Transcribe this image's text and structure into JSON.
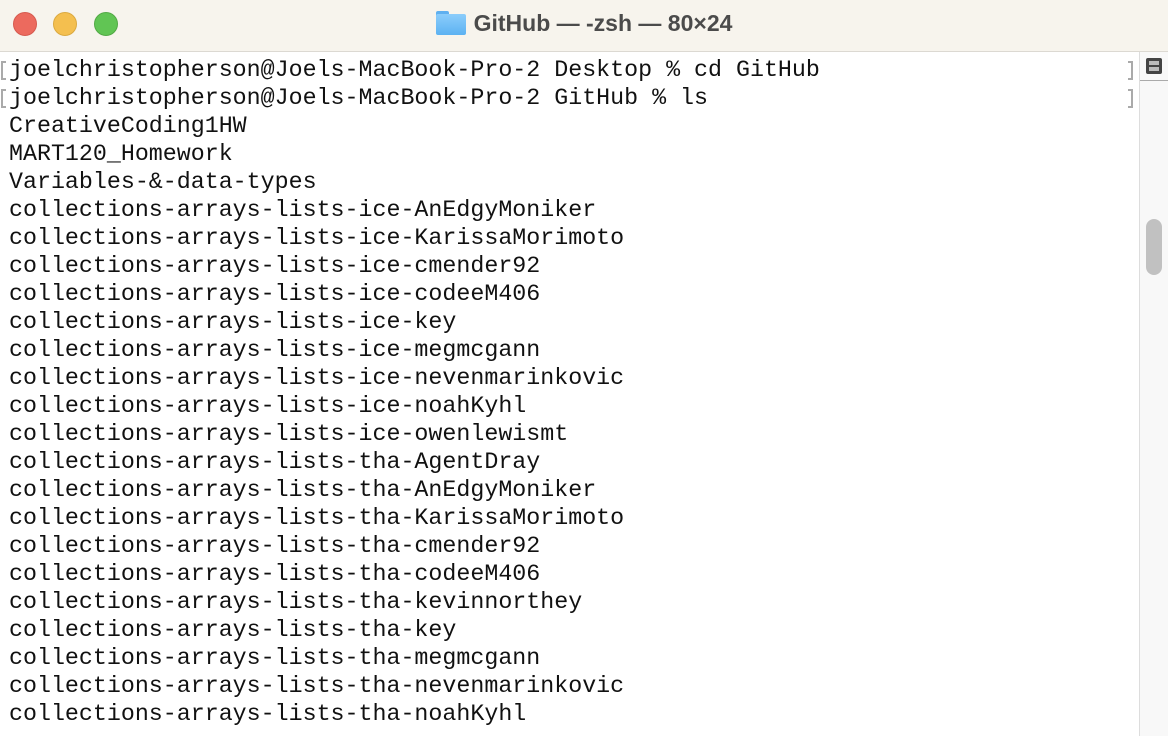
{
  "window": {
    "title": "GitHub — -zsh — 80×24"
  },
  "terminal": {
    "lines": [
      "joelchristopherson@Joels-MacBook-Pro-2 Desktop % cd GitHub",
      "joelchristopherson@Joels-MacBook-Pro-2 GitHub % ls",
      "CreativeCoding1HW",
      "MART120_Homework",
      "Variables-&-data-types",
      "collections-arrays-lists-ice-AnEdgyMoniker",
      "collections-arrays-lists-ice-KarissaMorimoto",
      "collections-arrays-lists-ice-cmender92",
      "collections-arrays-lists-ice-codeeM406",
      "collections-arrays-lists-ice-key",
      "collections-arrays-lists-ice-megmcgann",
      "collections-arrays-lists-ice-nevenmarinkovic",
      "collections-arrays-lists-ice-noahKyhl",
      "collections-arrays-lists-ice-owenlewismt",
      "collections-arrays-lists-tha-AgentDray",
      "collections-arrays-lists-tha-AnEdgyMoniker",
      "collections-arrays-lists-tha-KarissaMorimoto",
      "collections-arrays-lists-tha-cmender92",
      "collections-arrays-lists-tha-codeeM406",
      "collections-arrays-lists-tha-kevinnorthey",
      "collections-arrays-lists-tha-key",
      "collections-arrays-lists-tha-megmcgann",
      "collections-arrays-lists-tha-nevenmarinkovic",
      "collections-arrays-lists-tha-noahKyhl"
    ]
  }
}
